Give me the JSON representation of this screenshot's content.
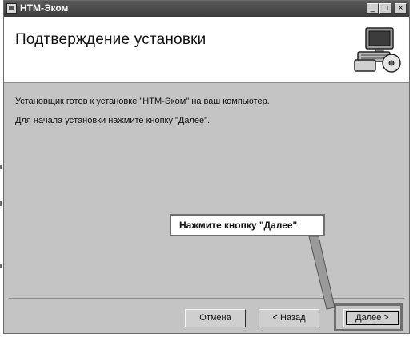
{
  "window": {
    "title": "НТМ-Эком",
    "controls": {
      "minimize": "_",
      "maximize": "□",
      "close": "×"
    }
  },
  "header": {
    "title": "Подтверждение установки",
    "icon": "computer-install-icon"
  },
  "body": {
    "line1": "Установщик готов к установке \"НТМ-Эком\" на ваш компьютер.",
    "line2": "Для начала установки нажмите кнопку \"Далее\"."
  },
  "buttons": {
    "cancel": "Отмена",
    "back": "< Назад",
    "next": "Далее >"
  },
  "callout": {
    "text": "Нажмите кнопку \"Далее\""
  },
  "colors": {
    "dialog_bg": "#c4c4c4",
    "titlebar": "#4a4a4a",
    "header_bg": "#ffffff"
  }
}
